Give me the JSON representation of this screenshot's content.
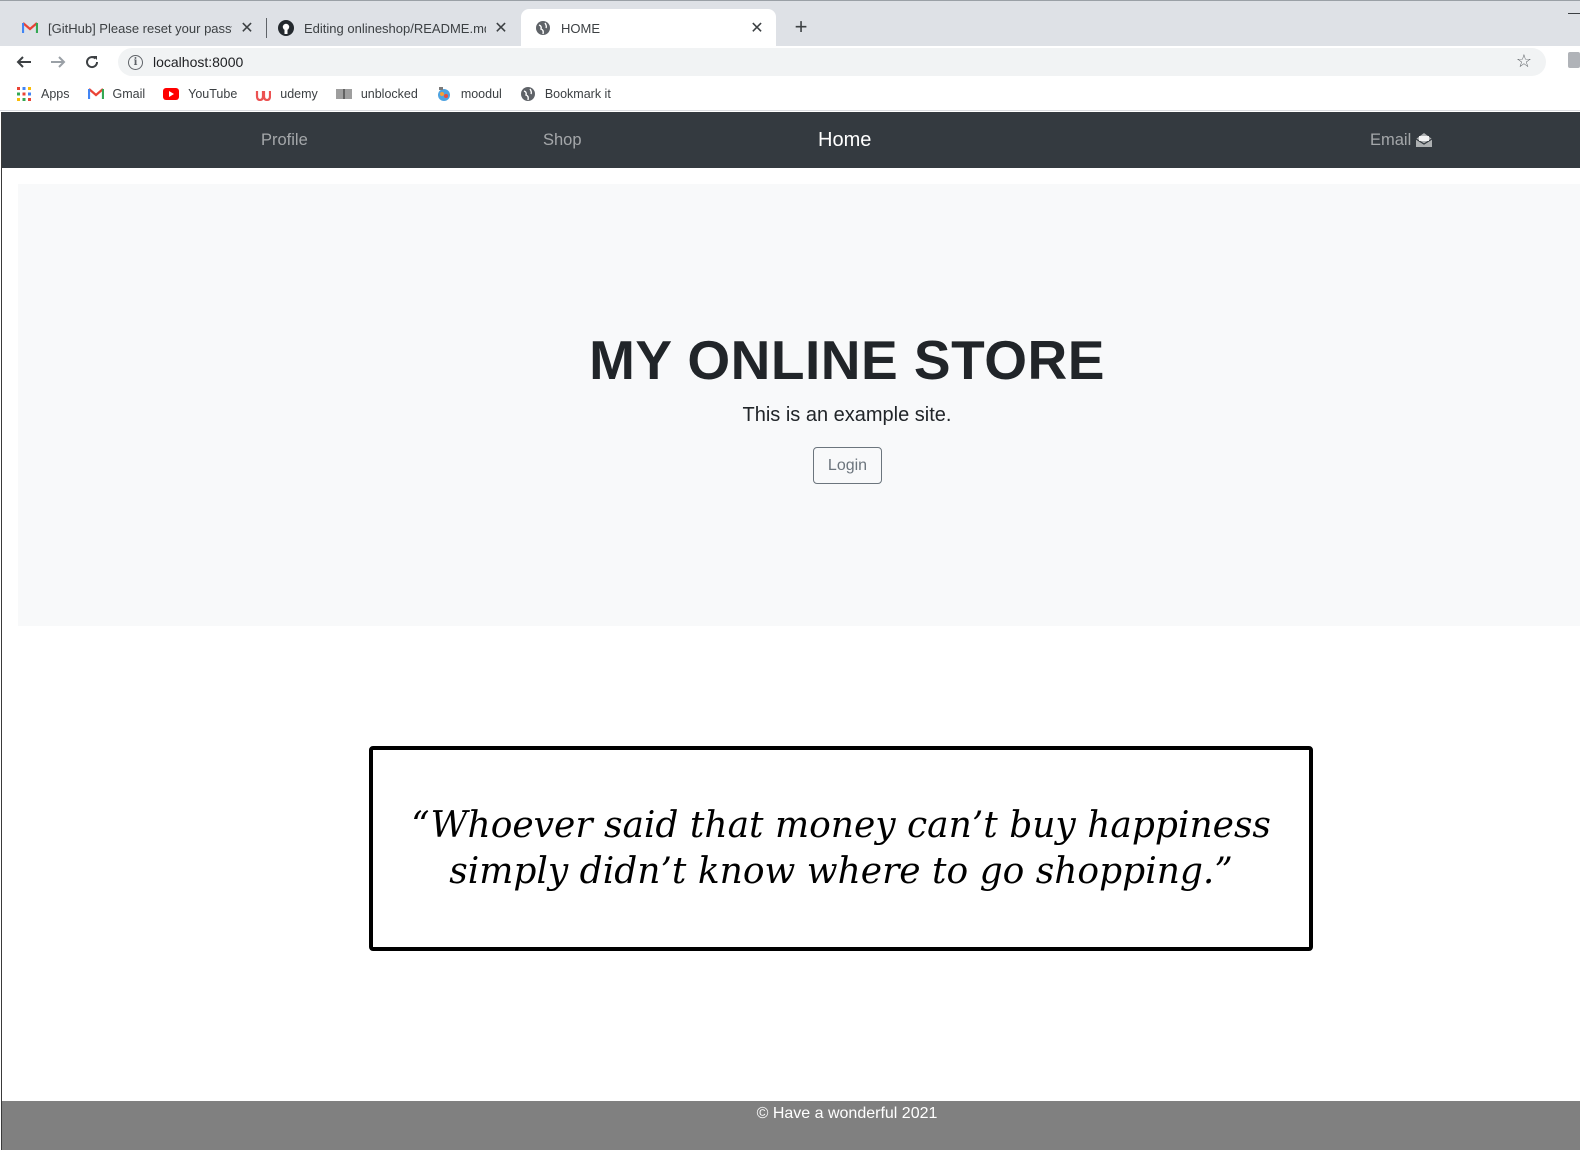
{
  "browser": {
    "tabs": [
      {
        "title": "[GitHub] Please reset your passw",
        "icon": "gmail-icon"
      },
      {
        "title": "Editing onlineshop/README.md",
        "icon": "github-icon"
      },
      {
        "title": "HOME",
        "icon": "globe-icon"
      }
    ],
    "new_tab_label": "+",
    "url": "localhost:8000",
    "bookmarks": [
      {
        "label": "Apps",
        "icon": "apps-grid-icon"
      },
      {
        "label": "Gmail",
        "icon": "gmail-icon"
      },
      {
        "label": "YouTube",
        "icon": "youtube-icon"
      },
      {
        "label": "udemy",
        "icon": "udemy-icon"
      },
      {
        "label": "unblocked",
        "icon": "book-icon"
      },
      {
        "label": "moodul",
        "icon": "moodul-icon"
      },
      {
        "label": "Bookmark it",
        "icon": "globe-icon"
      }
    ]
  },
  "navbar": {
    "profile": "Profile",
    "shop": "Shop",
    "home": "Home",
    "email": "Email"
  },
  "hero": {
    "title": "MY ONLINE STORE",
    "subtitle": "This is an example site.",
    "login_label": "Login"
  },
  "quote": {
    "text": "“Whoever said that money can’t buy happiness simply didn’t know where to go shopping.”"
  },
  "footer": {
    "text": "© Have a wonderful 2021"
  },
  "colors": {
    "navbar_bg": "#343a40",
    "jumbotron_bg": "#f8f9fa",
    "footer_bg": "#808080",
    "tabbar_bg": "#dee1e6"
  }
}
